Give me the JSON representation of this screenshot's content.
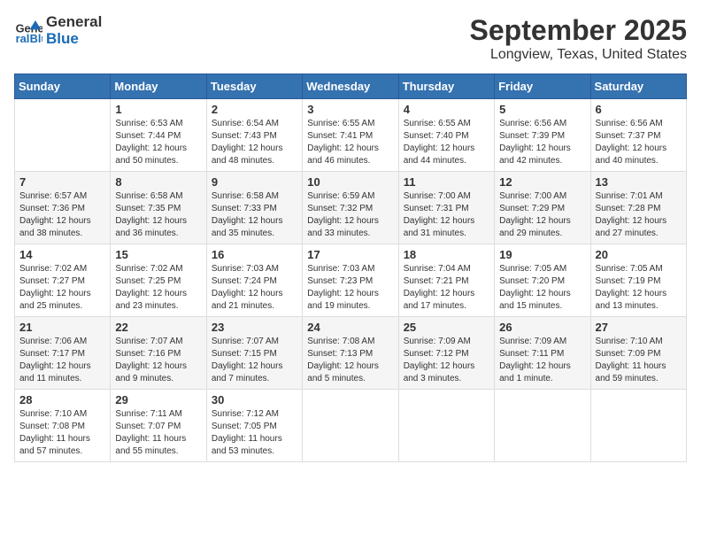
{
  "logo": {
    "line1": "General",
    "line2": "Blue"
  },
  "title": "September 2025",
  "subtitle": "Longview, Texas, United States",
  "days_of_week": [
    "Sunday",
    "Monday",
    "Tuesday",
    "Wednesday",
    "Thursday",
    "Friday",
    "Saturday"
  ],
  "weeks": [
    [
      {
        "day": "",
        "content": ""
      },
      {
        "day": "1",
        "content": "Sunrise: 6:53 AM\nSunset: 7:44 PM\nDaylight: 12 hours\nand 50 minutes."
      },
      {
        "day": "2",
        "content": "Sunrise: 6:54 AM\nSunset: 7:43 PM\nDaylight: 12 hours\nand 48 minutes."
      },
      {
        "day": "3",
        "content": "Sunrise: 6:55 AM\nSunset: 7:41 PM\nDaylight: 12 hours\nand 46 minutes."
      },
      {
        "day": "4",
        "content": "Sunrise: 6:55 AM\nSunset: 7:40 PM\nDaylight: 12 hours\nand 44 minutes."
      },
      {
        "day": "5",
        "content": "Sunrise: 6:56 AM\nSunset: 7:39 PM\nDaylight: 12 hours\nand 42 minutes."
      },
      {
        "day": "6",
        "content": "Sunrise: 6:56 AM\nSunset: 7:37 PM\nDaylight: 12 hours\nand 40 minutes."
      }
    ],
    [
      {
        "day": "7",
        "content": "Sunrise: 6:57 AM\nSunset: 7:36 PM\nDaylight: 12 hours\nand 38 minutes."
      },
      {
        "day": "8",
        "content": "Sunrise: 6:58 AM\nSunset: 7:35 PM\nDaylight: 12 hours\nand 36 minutes."
      },
      {
        "day": "9",
        "content": "Sunrise: 6:58 AM\nSunset: 7:33 PM\nDaylight: 12 hours\nand 35 minutes."
      },
      {
        "day": "10",
        "content": "Sunrise: 6:59 AM\nSunset: 7:32 PM\nDaylight: 12 hours\nand 33 minutes."
      },
      {
        "day": "11",
        "content": "Sunrise: 7:00 AM\nSunset: 7:31 PM\nDaylight: 12 hours\nand 31 minutes."
      },
      {
        "day": "12",
        "content": "Sunrise: 7:00 AM\nSunset: 7:29 PM\nDaylight: 12 hours\nand 29 minutes."
      },
      {
        "day": "13",
        "content": "Sunrise: 7:01 AM\nSunset: 7:28 PM\nDaylight: 12 hours\nand 27 minutes."
      }
    ],
    [
      {
        "day": "14",
        "content": "Sunrise: 7:02 AM\nSunset: 7:27 PM\nDaylight: 12 hours\nand 25 minutes."
      },
      {
        "day": "15",
        "content": "Sunrise: 7:02 AM\nSunset: 7:25 PM\nDaylight: 12 hours\nand 23 minutes."
      },
      {
        "day": "16",
        "content": "Sunrise: 7:03 AM\nSunset: 7:24 PM\nDaylight: 12 hours\nand 21 minutes."
      },
      {
        "day": "17",
        "content": "Sunrise: 7:03 AM\nSunset: 7:23 PM\nDaylight: 12 hours\nand 19 minutes."
      },
      {
        "day": "18",
        "content": "Sunrise: 7:04 AM\nSunset: 7:21 PM\nDaylight: 12 hours\nand 17 minutes."
      },
      {
        "day": "19",
        "content": "Sunrise: 7:05 AM\nSunset: 7:20 PM\nDaylight: 12 hours\nand 15 minutes."
      },
      {
        "day": "20",
        "content": "Sunrise: 7:05 AM\nSunset: 7:19 PM\nDaylight: 12 hours\nand 13 minutes."
      }
    ],
    [
      {
        "day": "21",
        "content": "Sunrise: 7:06 AM\nSunset: 7:17 PM\nDaylight: 12 hours\nand 11 minutes."
      },
      {
        "day": "22",
        "content": "Sunrise: 7:07 AM\nSunset: 7:16 PM\nDaylight: 12 hours\nand 9 minutes."
      },
      {
        "day": "23",
        "content": "Sunrise: 7:07 AM\nSunset: 7:15 PM\nDaylight: 12 hours\nand 7 minutes."
      },
      {
        "day": "24",
        "content": "Sunrise: 7:08 AM\nSunset: 7:13 PM\nDaylight: 12 hours\nand 5 minutes."
      },
      {
        "day": "25",
        "content": "Sunrise: 7:09 AM\nSunset: 7:12 PM\nDaylight: 12 hours\nand 3 minutes."
      },
      {
        "day": "26",
        "content": "Sunrise: 7:09 AM\nSunset: 7:11 PM\nDaylight: 12 hours\nand 1 minute."
      },
      {
        "day": "27",
        "content": "Sunrise: 7:10 AM\nSunset: 7:09 PM\nDaylight: 11 hours\nand 59 minutes."
      }
    ],
    [
      {
        "day": "28",
        "content": "Sunrise: 7:10 AM\nSunset: 7:08 PM\nDaylight: 11 hours\nand 57 minutes."
      },
      {
        "day": "29",
        "content": "Sunrise: 7:11 AM\nSunset: 7:07 PM\nDaylight: 11 hours\nand 55 minutes."
      },
      {
        "day": "30",
        "content": "Sunrise: 7:12 AM\nSunset: 7:05 PM\nDaylight: 11 hours\nand 53 minutes."
      },
      {
        "day": "",
        "content": ""
      },
      {
        "day": "",
        "content": ""
      },
      {
        "day": "",
        "content": ""
      },
      {
        "day": "",
        "content": ""
      }
    ]
  ]
}
